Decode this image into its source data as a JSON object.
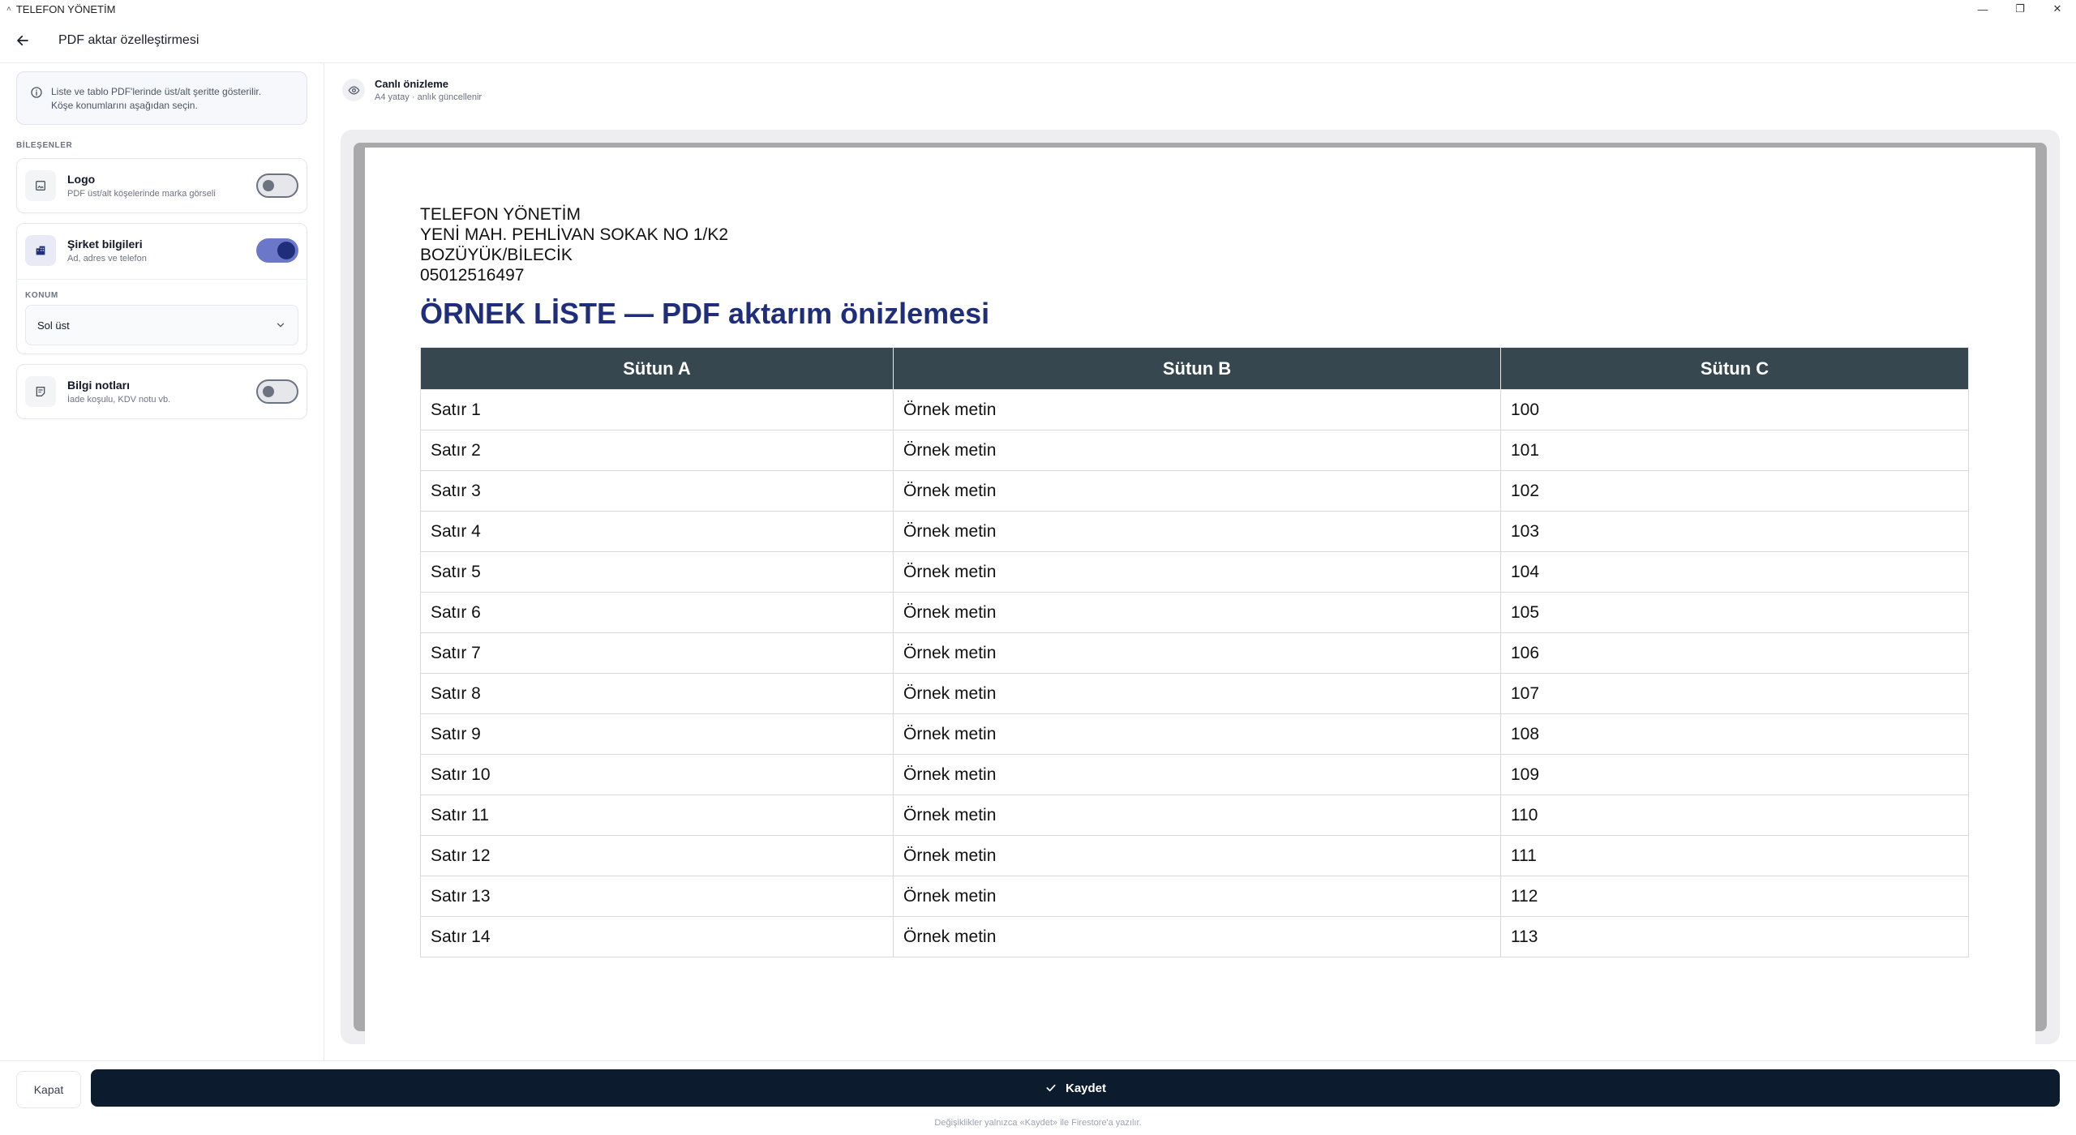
{
  "window": {
    "title": "TELEFON YÖNETİM",
    "controls": [
      "—",
      "❐",
      "✕"
    ]
  },
  "header": {
    "title": "PDF aktar özelleştirmesi"
  },
  "sidebar": {
    "info_text_1": "Liste ve tablo PDF'lerinde üst/alt şeritte gösterilir.",
    "info_text_2": "Köşe konumlarını aşağıdan seçin.",
    "section_label": "BİLEŞENLER",
    "components": [
      {
        "title": "Logo",
        "subtitle": "PDF üst/alt köşelerinde marka görseli",
        "enabled": false
      },
      {
        "title": "Şirket bilgileri",
        "subtitle": "Ad, adres ve telefon",
        "enabled": true,
        "field_label": "KONUM",
        "position_value": "Sol üst"
      },
      {
        "title": "Bilgi notları",
        "subtitle": "İade koşulu, KDV notu vb.",
        "enabled": false
      }
    ]
  },
  "preview": {
    "title": "Canlı önizleme",
    "subtitle": "A4 yatay · anlık güncellenir",
    "company": {
      "name": "TELEFON YÖNETİM",
      "address": "YENİ MAH. PEHLİVAN SOKAK NO 1/K2",
      "city": "BOZÜYÜK/BİLECİK",
      "phone": "05012516497"
    },
    "doc_title": "ÖRNEK LİSTE — PDF aktarım önizlemesi",
    "columns": [
      "Sütun A",
      "Sütun B",
      "Sütun C"
    ],
    "rows": [
      [
        "Satır 1",
        "Örnek metin",
        "100"
      ],
      [
        "Satır 2",
        "Örnek metin",
        "101"
      ],
      [
        "Satır 3",
        "Örnek metin",
        "102"
      ],
      [
        "Satır 4",
        "Örnek metin",
        "103"
      ],
      [
        "Satır 5",
        "Örnek metin",
        "104"
      ],
      [
        "Satır 6",
        "Örnek metin",
        "105"
      ],
      [
        "Satır 7",
        "Örnek metin",
        "106"
      ],
      [
        "Satır 8",
        "Örnek metin",
        "107"
      ],
      [
        "Satır 9",
        "Örnek metin",
        "108"
      ],
      [
        "Satır 10",
        "Örnek metin",
        "109"
      ],
      [
        "Satır 11",
        "Örnek metin",
        "110"
      ],
      [
        "Satır 12",
        "Örnek metin",
        "111"
      ],
      [
        "Satır 13",
        "Örnek metin",
        "112"
      ],
      [
        "Satır 14",
        "Örnek metin",
        "113"
      ]
    ]
  },
  "footer": {
    "close_label": "Kapat",
    "save_label": "Kaydet",
    "note": "Değişiklikler yalnızca «Kaydet» ile Firestore'a yazılır."
  },
  "colors": {
    "accent": "#1f2e7a",
    "table_header": "#37474f",
    "save_button": "#0d1b2e"
  }
}
